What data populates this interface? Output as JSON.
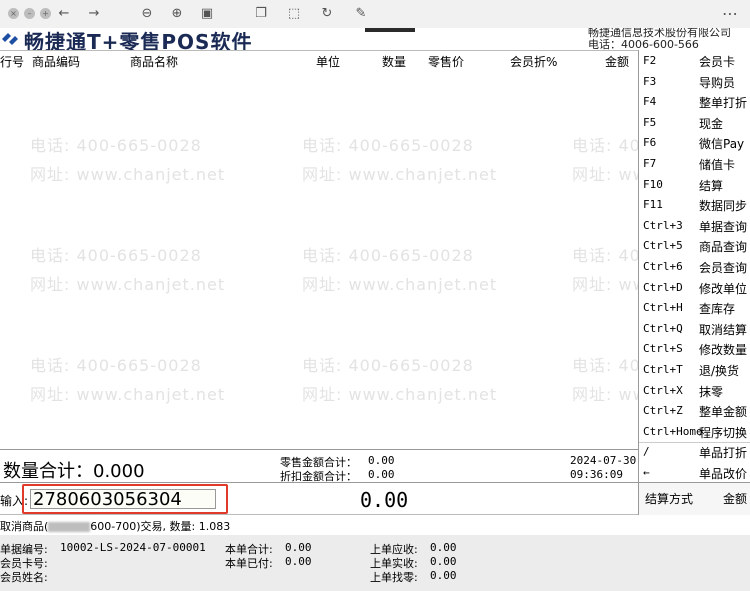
{
  "app": {
    "title": "畅捷通T+零售POS软件",
    "company": "畅捷通信息技术股份有限公司",
    "phone": "电话：4006-600-566"
  },
  "toolbar": {
    "icons": [
      "back-icon",
      "forward-icon",
      "zoom-out-icon",
      "zoom-in-icon",
      "fit-icon",
      "copy-icon",
      "select-icon",
      "rotate-icon",
      "tools-icon",
      "more-icon"
    ]
  },
  "table": {
    "headers": [
      "行号",
      "商品编码",
      "商品名称",
      "单位",
      "数量",
      "零售价",
      "会员折%",
      "金额"
    ]
  },
  "watermark": {
    "line1": "电话: 400-665-0028",
    "line2": "网址: www.chanjet.net"
  },
  "fkeys": [
    {
      "key": "F2",
      "label": "会员卡"
    },
    {
      "key": "F3",
      "label": "导购员"
    },
    {
      "key": "F4",
      "label": "整单打折"
    },
    {
      "key": "F5",
      "label": "现金"
    },
    {
      "key": "F6",
      "label": "微信Pay"
    },
    {
      "key": "F7",
      "label": "储值卡"
    },
    {
      "key": "F10",
      "label": "结算"
    },
    {
      "key": "F11",
      "label": "数据同步"
    },
    {
      "key": "Ctrl+3",
      "label": "单据查询"
    },
    {
      "key": "Ctrl+5",
      "label": "商品查询"
    },
    {
      "key": "Ctrl+6",
      "label": "会员查询"
    },
    {
      "key": "Ctrl+D",
      "label": "修改单位"
    },
    {
      "key": "Ctrl+H",
      "label": "查库存"
    },
    {
      "key": "Ctrl+Q",
      "label": "取消结算"
    },
    {
      "key": "Ctrl+S",
      "label": "修改数量"
    },
    {
      "key": "Ctrl+T",
      "label": "退/换货"
    },
    {
      "key": "Ctrl+X",
      "label": "抹零"
    },
    {
      "key": "Ctrl+Z",
      "label": "整单金额"
    },
    {
      "key": "Ctrl+Home",
      "label": "程序切换"
    },
    {
      "key": "/",
      "label": "单品打折"
    },
    {
      "key": "←",
      "label": "单品改价"
    }
  ],
  "summary": {
    "qty_total": "数量合计：0.000",
    "retail_total_label": "零售金额合计：",
    "retail_total_value": "0.00",
    "discount_total_label": "折扣金额合计：",
    "discount_total_value": "0.00",
    "date": "2024-07-30",
    "time": "09:36:09"
  },
  "input": {
    "label": "输入:",
    "value": "2780603056304",
    "amount": "0.00"
  },
  "settle": {
    "method_label": "结算方式",
    "amount_label": "金额"
  },
  "message": {
    "prefix": "取消商品(",
    "suffix": "600-700)交易, 数量: 1.083"
  },
  "bottom": {
    "doc_no_label": "单据编号:",
    "doc_no": "10002-LS-2024-07-00001",
    "member_card_label": "会员卡号:",
    "member_name_label": "会员姓名:",
    "total_label": "本单合计:",
    "total_value": "0.00",
    "paid_label": "本单已付:",
    "paid_value": "0.00",
    "last_due_label": "上单应收:",
    "last_due_value": "0.00",
    "last_received_label": "上单实收:",
    "last_received_value": "0.00",
    "last_change_label": "上单找零:",
    "last_change_value": "0.00"
  }
}
